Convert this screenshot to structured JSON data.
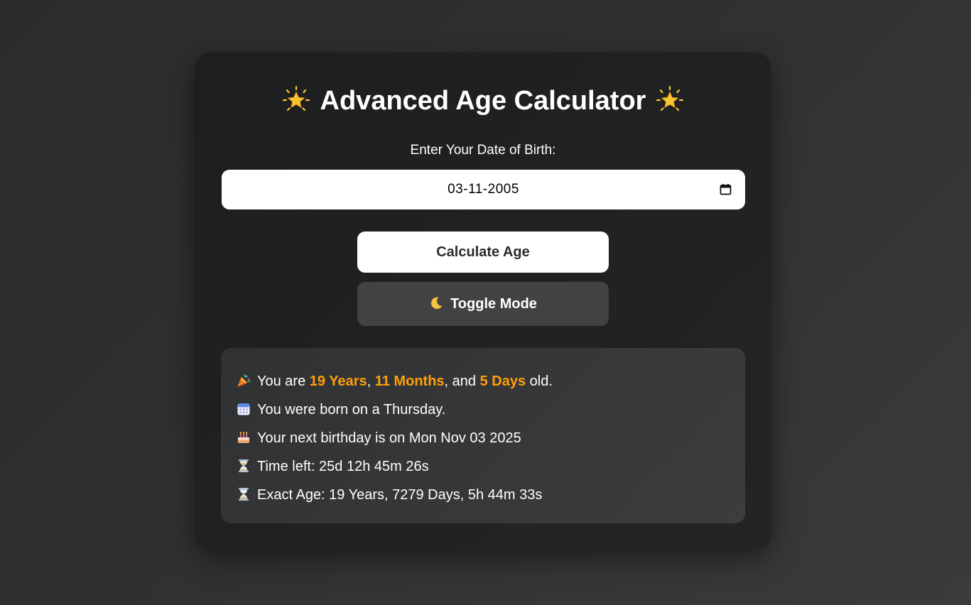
{
  "app": {
    "title": "Advanced Age Calculator",
    "title_icon": "glowing-star-icon"
  },
  "form": {
    "dob_label": "Enter Your Date of Birth:",
    "dob_value": "03-11-2005",
    "calendar_icon": "calendar-icon"
  },
  "buttons": {
    "calculate_label": "Calculate Age",
    "toggle_label": "Toggle Mode",
    "toggle_icon": "crescent-moon-icon"
  },
  "result": {
    "age_prefix": "You are",
    "years": "19 Years",
    "sep1": ",",
    "months": "11 Months",
    "sep2": ", and",
    "days": "5 Days",
    "age_suffix": "old.",
    "born_day": "You were born on a Thursday.",
    "next_birthday": "Your next birthday is on Mon Nov 03 2025",
    "time_left": "Time left: 25d 12h 45m 26s",
    "exact_age": "Exact Age: 19 Years, 7279 Days, 5h 44m 33s",
    "icons": [
      "party-popper-icon",
      "calendar-icon",
      "birthday-cake-icon",
      "hourglass-icon",
      "hourglass-icon"
    ]
  },
  "colors": {
    "highlight": "#ff9f0a",
    "card_bg": "#1f2021",
    "result_bg": "#353637",
    "toggle_bg": "#424242"
  }
}
